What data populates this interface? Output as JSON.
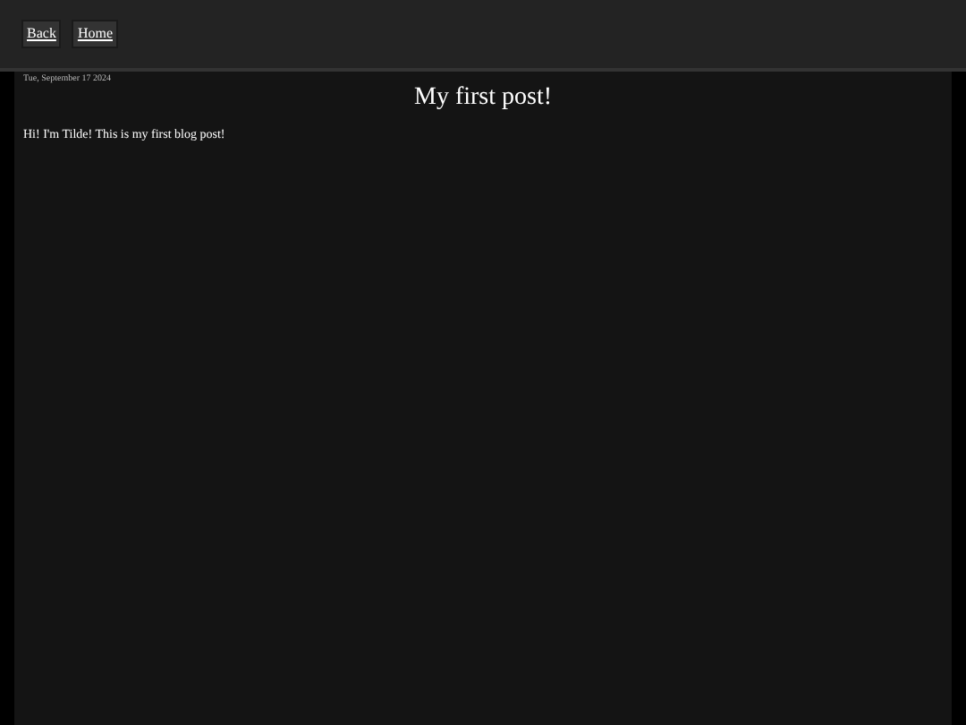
{
  "nav": {
    "links": [
      "Back",
      "Home"
    ]
  },
  "post": {
    "date": "Tue, September 17 2024",
    "title": "My first post!",
    "body": "Hi! I'm Tilde! This is my first blog post!"
  }
}
